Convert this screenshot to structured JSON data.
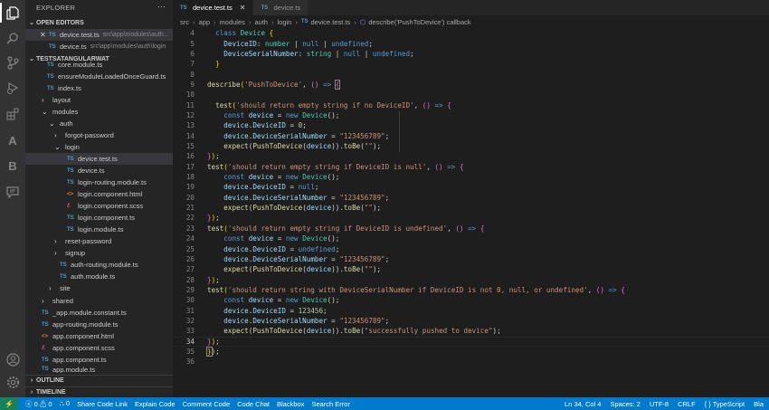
{
  "activity": {
    "items": [
      "explorer-icon",
      "search-icon",
      "source-control-icon",
      "run-debug-icon",
      "extensions-icon",
      "azure-icon",
      "blackbox-icon",
      "chat-icon"
    ],
    "bottom": [
      "account-icon",
      "settings-gear-icon"
    ],
    "azure_glyph": "A",
    "blackbox_glyph": "B"
  },
  "explorer": {
    "title": "EXPLORER",
    "more": "···",
    "open_editors_header": "OPEN EDITORS",
    "open_editors": [
      {
        "icon": "TS",
        "name": "device.test.ts",
        "path": "src\\app\\modules\\auth...",
        "close": "✕"
      },
      {
        "icon": "TS",
        "name": "device.ts",
        "path": "src\\app\\modules\\auth\\login"
      }
    ],
    "project_header": "TESTSATANGULARWAT",
    "tree": [
      {
        "icon": "TS",
        "name": "core.module.ts"
      },
      {
        "icon": "TS",
        "name": "ensureModuleLoadedOnceGuard.ts"
      },
      {
        "icon": "TS",
        "name": "index.ts"
      },
      {
        "icon": "›",
        "name": "layout"
      },
      {
        "icon": "⌄",
        "name": "modules"
      },
      {
        "icon": "⌄",
        "name": "auth"
      },
      {
        "icon": "›",
        "name": "forgot-password"
      },
      {
        "icon": "⌄",
        "name": "login"
      },
      {
        "icon": "TS",
        "name": "device.test.ts"
      },
      {
        "icon": "TS",
        "name": "device.ts"
      },
      {
        "icon": "TS",
        "name": "login-routing.module.ts"
      },
      {
        "icon": "<>",
        "name": "login.component.html"
      },
      {
        "icon": "ℰ",
        "name": "login.component.scss"
      },
      {
        "icon": "TS",
        "name": "login.component.ts"
      },
      {
        "icon": "TS",
        "name": "login.module.ts"
      },
      {
        "icon": "›",
        "name": "reset-password"
      },
      {
        "icon": "›",
        "name": "signup"
      },
      {
        "icon": "TS",
        "name": "auth-routing.module.ts"
      },
      {
        "icon": "TS",
        "name": "auth.module.ts"
      },
      {
        "icon": "›",
        "name": "site"
      },
      {
        "icon": "›",
        "name": "shared"
      },
      {
        "icon": "TS",
        "name": "_app.module.constant.ts"
      },
      {
        "icon": "TS",
        "name": "app-routing.module.ts"
      },
      {
        "icon": "<>",
        "name": "app.component.html"
      },
      {
        "icon": "ℰ",
        "name": "app.component.scss"
      },
      {
        "icon": "TS",
        "name": "app.component.ts"
      },
      {
        "icon": "TS",
        "name": "app.module.ts"
      }
    ],
    "outline_header": "OUTLINE",
    "timeline_header": "TIMELINE"
  },
  "tabs": [
    {
      "icon": "TS",
      "label": "device.test.ts",
      "close": "✕",
      "active": true
    },
    {
      "icon": "TS",
      "label": "device.ts",
      "active": false
    }
  ],
  "breadcrumb": {
    "segments": [
      "src",
      "app",
      "modules",
      "auth",
      "login"
    ],
    "file_icon": "TS",
    "file": "device.test.ts",
    "symbol": "describe('PushToDevice') callback",
    "sep": "›"
  },
  "editor": {
    "current_line": 34,
    "line_numbers": [
      "4",
      "5",
      "6",
      "7",
      "8",
      "9",
      "10",
      "11",
      "12",
      "13",
      "14",
      "15",
      "16",
      "17",
      "18",
      "19",
      "20",
      "21",
      "22",
      "23",
      "24",
      "25",
      "26",
      "27",
      "28",
      "29",
      "30",
      "31",
      "32",
      "33",
      "34",
      "35",
      "36"
    ]
  },
  "statusbar": {
    "remote": "⚡",
    "problems": "ⓧ 0 ⚠ 0",
    "ports": "⛬ 0",
    "items_left": [
      "Share Code Link",
      "Explain Code",
      "Comment Code",
      "Code Chat",
      "Blackbox",
      "Search Error"
    ],
    "position": "Ln 34, Col 4",
    "spaces": "Spaces: 2",
    "encoding": "UTF-8",
    "eol": "CRLF",
    "language": "{ } TypeScript",
    "extra": "Bla"
  }
}
